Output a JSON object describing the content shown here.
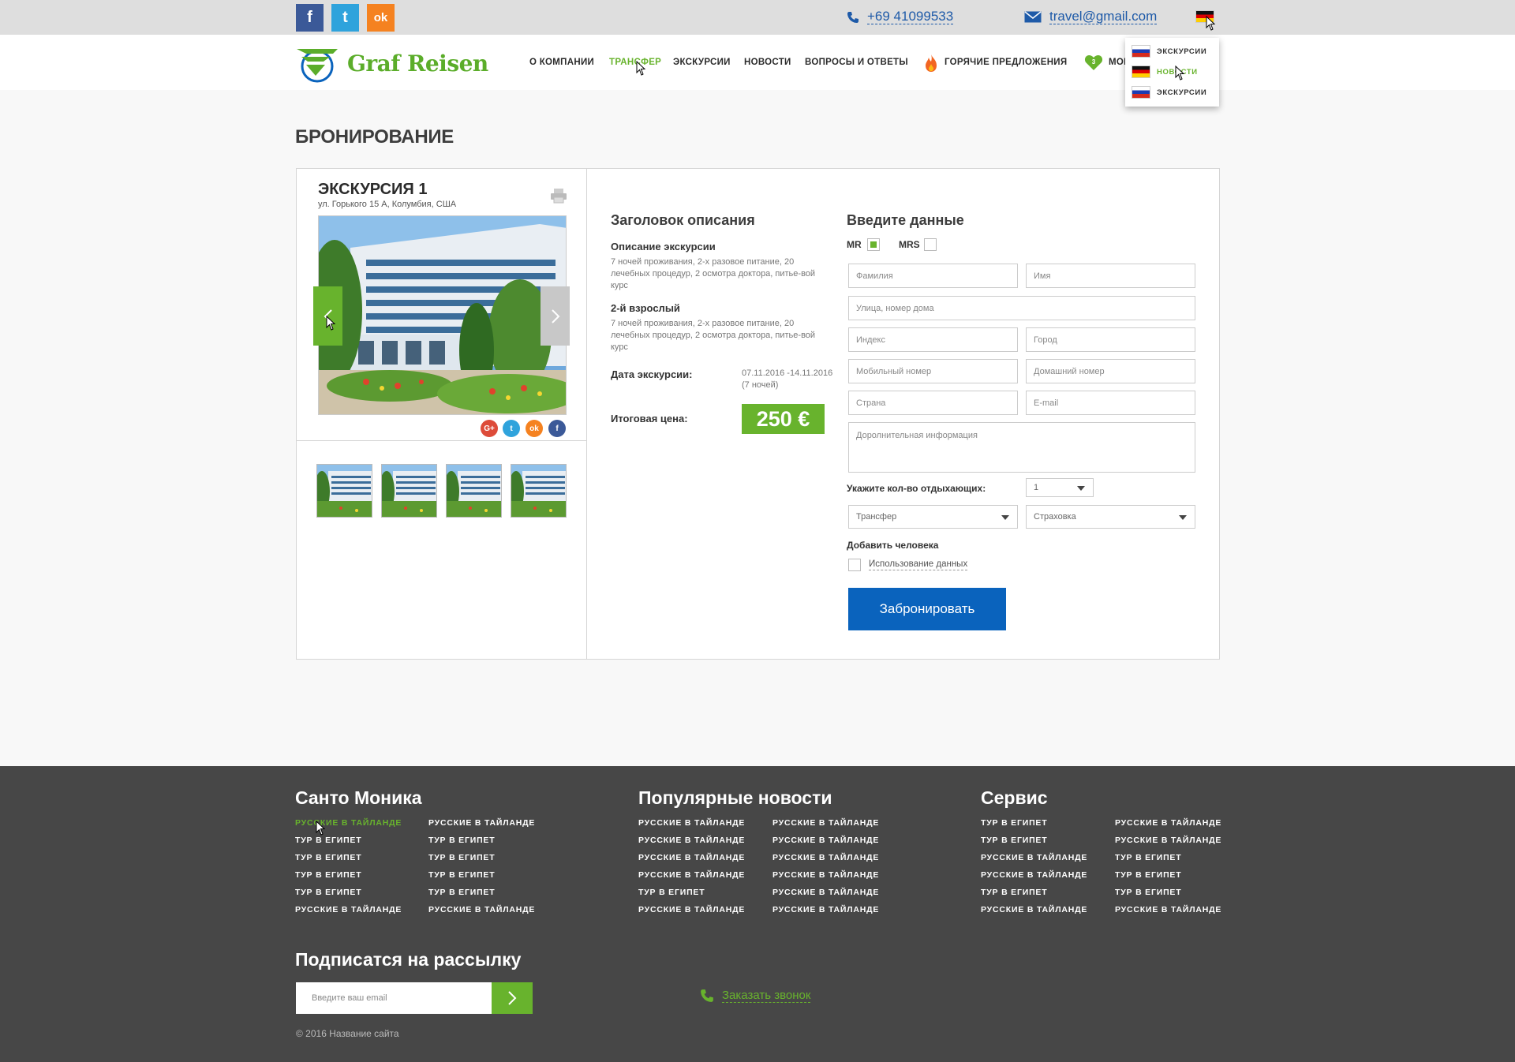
{
  "topbar": {
    "social": [
      {
        "name": "facebook",
        "glyph": "f"
      },
      {
        "name": "twitter",
        "glyph": "t"
      },
      {
        "name": "odnoklassniki",
        "glyph": "ok"
      }
    ],
    "phone": "+69 41099533",
    "email": "travel@gmail.com",
    "current_language_flag": "de"
  },
  "logo": {
    "name": "Graf Reisen"
  },
  "nav": {
    "items": [
      "О КОМПАНИИ",
      "ТРАНСФЕР",
      "ЭКСКУРСИИ",
      "НОВОСТИ",
      "ВОПРОСЫ И ОТВЕТЫ",
      "ГОРЯЧИЕ ПРЕДЛОЖЕНИЯ",
      "МОИ"
    ],
    "active": "ТРАНСФЕР",
    "favorites_count": "3"
  },
  "language_dropdown": [
    {
      "flag": "ru",
      "label": "ЭКСКУРСИИ"
    },
    {
      "flag": "de",
      "label": "НОВОСТИ"
    },
    {
      "flag": "ru",
      "label": "ЭКСКУРСИИ"
    }
  ],
  "page_title": "БРОНИРОВАНИЕ",
  "excursion": {
    "title": "ЭКСКУРСИЯ 1",
    "address": "ул. Горького 15 А, Колумбия, США",
    "share_icons": [
      "google-plus",
      "twitter",
      "odnoklassniki",
      "facebook"
    ],
    "share_glyphs": {
      "gplus": "G+",
      "tw": "t",
      "ok": "ok",
      "fb": "f"
    }
  },
  "description": {
    "heading": "Заголовок описания",
    "sections": [
      {
        "title": "Описание экскурсии",
        "text": "7 ночей проживания, 2-х разовое питание, 20 лечебных процедур, 2 осмотра доктора, питье-вой курс"
      },
      {
        "title": "2-й взрослый",
        "text": "7 ночей проживания, 2-х разовое питание, 20 лечебных процедур, 2 осмотра доктора, питье-вой курс"
      }
    ],
    "date_label": "Дата экскурсии:",
    "date_value": "07.11.2016 -14.11.2016",
    "date_nights": "(7 ночей)",
    "price_label": "Итоговая цена:",
    "price_value": "250 €"
  },
  "form": {
    "heading": "Введите данные",
    "title_mr": "MR",
    "title_mrs": "MRS",
    "selected_title": "MR",
    "placeholders": {
      "last_name": "Фамилия",
      "first_name": "Имя",
      "street": "Улица, номер дома",
      "zip": "Индекс",
      "city": "Город",
      "mobile": "Мобильный номер",
      "home_phone": "Домашний номер",
      "country": "Страна",
      "email": "E-mail",
      "additional": "Доролнительная информация"
    },
    "guests_label": "Укажите кол-во отдыхающих:",
    "guests_value": "1",
    "transfer_select": "Трансфер",
    "insurance_select": "Страховка",
    "add_person": "Добавить человека",
    "use_data_label": "Использование данных",
    "use_data_checked": false,
    "submit": "Забронировать"
  },
  "footer": {
    "columns": [
      {
        "title": "Санто Моника",
        "col1": [
          "РУССКИЕ В ТАЙЛАНДЕ",
          "ТУР В ЕГИПЕТ",
          "ТУР В ЕГИПЕТ",
          "ТУР В ЕГИПЕТ",
          "ТУР В ЕГИПЕТ",
          "РУССКИЕ В ТАЙЛАНДЕ"
        ],
        "col2": [
          "РУССКИЕ В ТАЙЛАНДЕ",
          "ТУР В ЕГИПЕТ",
          "ТУР В ЕГИПЕТ",
          "ТУР В ЕГИПЕТ",
          "ТУР В ЕГИПЕТ",
          "РУССКИЕ В ТАЙЛАНДЕ"
        ]
      },
      {
        "title": "Популярные новости",
        "col1": [
          "РУССКИЕ В ТАЙЛАНДЕ",
          "РУССКИЕ В ТАЙЛАНДЕ",
          "РУССКИЕ В ТАЙЛАНДЕ",
          "РУССКИЕ В ТАЙЛАНДЕ",
          "ТУР В ЕГИПЕТ",
          "РУССКИЕ В ТАЙЛАНДЕ"
        ],
        "col2": [
          "РУССКИЕ В ТАЙЛАНДЕ",
          "РУССКИЕ В ТАЙЛАНДЕ",
          "РУССКИЕ В ТАЙЛАНДЕ",
          "РУССКИЕ В ТАЙЛАНДЕ",
          "РУССКИЕ В ТАЙЛАНДЕ",
          "РУССКИЕ В ТАЙЛАНДЕ"
        ]
      },
      {
        "title": "Сервис",
        "col1": [
          "ТУР В ЕГИПЕТ",
          "ТУР В ЕГИПЕТ",
          "РУССКИЕ В ТАЙЛАНДЕ",
          "РУССКИЕ В ТАЙЛАНДЕ",
          "ТУР В ЕГИПЕТ",
          "РУССКИЕ В ТАЙЛАНДЕ"
        ],
        "col2": [
          "РУССКИЕ В ТАЙЛАНДЕ",
          "РУССКИЕ В ТАЙЛАНДЕ",
          "ТУР В ЕГИПЕТ",
          "ТУР В ЕГИПЕТ",
          "ТУР В ЕГИПЕТ",
          "РУССКИЕ В ТАЙЛАНДЕ"
        ]
      }
    ],
    "subscribe_title": "Подписатся на рассылку",
    "subscribe_placeholder": "Введите ваш email",
    "callback": "Заказать звонок",
    "copyright": "© 2016 Название сайта"
  },
  "colors": {
    "accent_green": "#68b32d",
    "primary_blue": "#0a63bd",
    "footer_bg": "#474747",
    "topbar_bg": "#dedede"
  }
}
